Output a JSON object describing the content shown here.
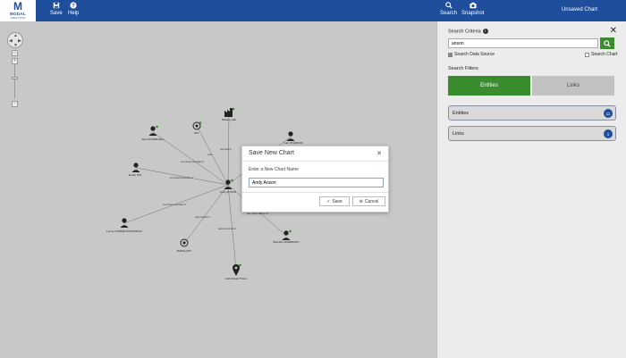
{
  "brand": {
    "mark": "M",
    "word": "MODAL",
    "sub": "ANALYTICS"
  },
  "toolbar": {
    "save_label": "Save",
    "help_label": "Help",
    "search_label": "Search",
    "snapshot_label": "Snapshot",
    "chart_status": "Unsaved Chart"
  },
  "panel": {
    "criteria_label": "Search Criteria",
    "search_value": "anson",
    "search_data_source_label": "Search Data Source",
    "search_chart_label": "Search Chart",
    "filters_label": "Search Filters",
    "tab_entities": "Entities",
    "tab_links": "Links",
    "results": [
      {
        "label": "Entities",
        "count": "11"
      },
      {
        "label": "Links",
        "count": "1"
      }
    ]
  },
  "modal": {
    "title": "Save New Chart",
    "prompt": "Enter a New Chart Name",
    "name_value": "Andy Anson",
    "save_label": "Save",
    "cancel_label": "Cancel"
  },
  "graph": {
    "nodes": [
      {
        "label": "Andy ANSON"
      },
      {
        "label": "Sam ROGERSELL"
      },
      {
        "label": "B/C"
      },
      {
        "label": "Battery Hall"
      },
      {
        "label": "Ivan JOHNSON"
      },
      {
        "label": "Emilio IPO"
      },
      {
        "label": "Lenny LOWERLOCKDESIGN"
      },
      {
        "label": "BURGLARY"
      },
      {
        "label": "Homestead Prison"
      },
      {
        "label": "Andrew JANSEN"
      },
      {
        "label": "Brandon ANDERSON"
      }
    ],
    "edges": [
      {
        "label": "is a known associate of"
      },
      {
        "label": "visits"
      },
      {
        "label": "has lived at"
      },
      {
        "label": "is a known associate of"
      },
      {
        "label": "is a known associate of"
      },
      {
        "label": "was suspect of"
      },
      {
        "label": "was sentenced at"
      },
      {
        "label": "has visited address of"
      }
    ]
  },
  "colors": {
    "brand_blue": "#1f4e9c",
    "accent_green": "#3a8d2f"
  }
}
